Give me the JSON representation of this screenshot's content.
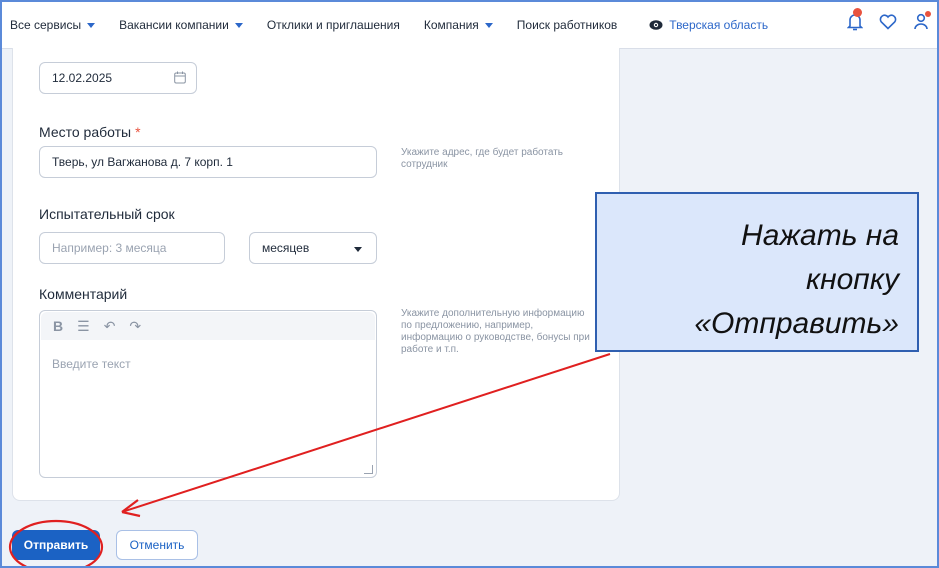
{
  "nav": {
    "items": [
      {
        "label": "Все сервисы",
        "has_caret": true
      },
      {
        "label": "Вакансии компании",
        "has_caret": true
      },
      {
        "label": "Отклики и приглашения",
        "has_caret": false
      },
      {
        "label": "Компания",
        "has_caret": true
      },
      {
        "label": "Поиск работников",
        "has_caret": false
      }
    ],
    "region": "Тверская область",
    "icons": [
      "eye-icon",
      "bell-icon",
      "heart-icon",
      "user-icon"
    ]
  },
  "form": {
    "date": {
      "value": "12.02.2025",
      "icon": "calendar-icon"
    },
    "workplace": {
      "label": "Место работы",
      "required_mark": "*",
      "value": "Тверь, ул Вагжанова д. 7 корп. 1",
      "hint": "Укажите адрес, где будет работать сотрудник"
    },
    "probation": {
      "label": "Испытательный срок",
      "placeholder": "Например: 3 месяца",
      "unit_selected": "месяцев"
    },
    "comment": {
      "label": "Комментарий",
      "placeholder": "Введите текст",
      "toolbar_icons": [
        "bold-icon",
        "list-icon",
        "undo-icon",
        "redo-icon"
      ],
      "hint": "Укажите дополнительную информацию по предложению, например, информацию о руководстве, бонусы при работе и т.п."
    }
  },
  "actions": {
    "submit": "Отправить",
    "cancel": "Отменить"
  },
  "annotation": {
    "callout_lines": [
      "Нажать на",
      "кнопку",
      "«Отправить»"
    ],
    "colors": {
      "arrow": "#e02020",
      "callout_border": "#2f5fb0",
      "callout_fill": "#dbe7fb"
    }
  },
  "colors": {
    "accent": "#1b62c4",
    "required": "#e8533f",
    "border_frame": "#5b8ad9"
  }
}
